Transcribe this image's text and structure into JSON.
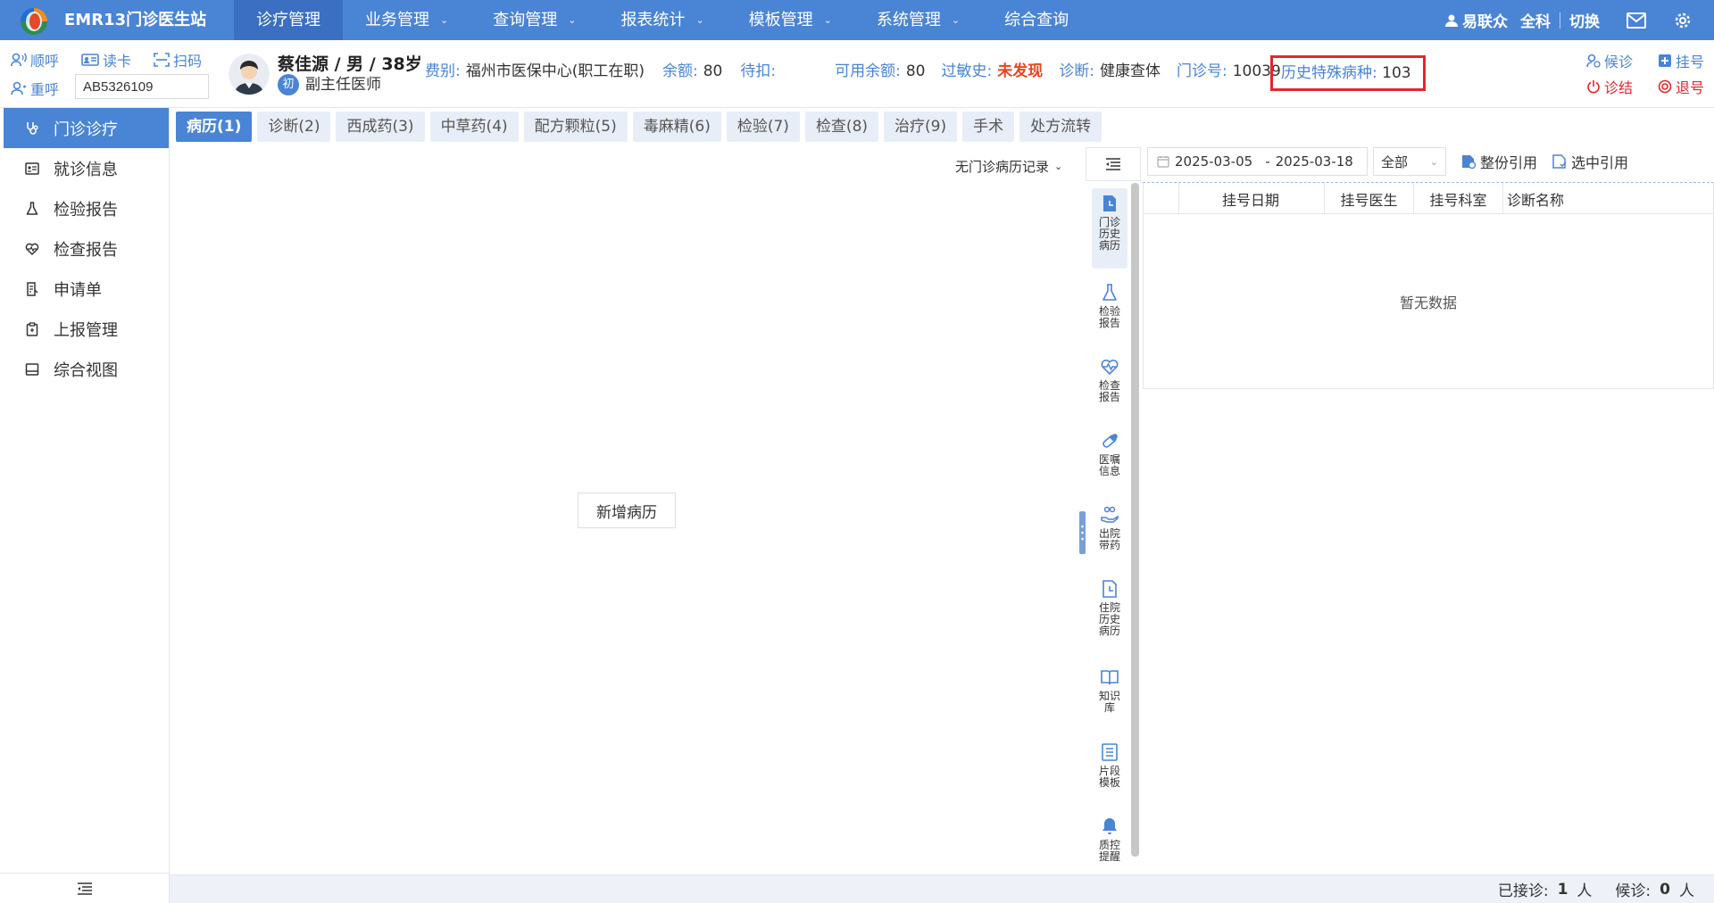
{
  "app": {
    "title": "EMR13门诊医生站"
  },
  "nav": [
    {
      "label": "诊疗管理",
      "active": true,
      "dropdown": false
    },
    {
      "label": "业务管理",
      "dropdown": true
    },
    {
      "label": "查询管理",
      "dropdown": true
    },
    {
      "label": "报表统计",
      "dropdown": true
    },
    {
      "label": "模板管理",
      "dropdown": true
    },
    {
      "label": "系统管理",
      "dropdown": true
    },
    {
      "label": "综合查询",
      "dropdown": false
    }
  ],
  "topright": {
    "user": "易联众",
    "dept": "全科",
    "switch_label": "切换"
  },
  "header": {
    "call_label": "顺呼",
    "readcard_label": "读卡",
    "scan_label": "扫码",
    "recall_label": "重呼",
    "card_value": "AB5326109",
    "wait_label": "候诊",
    "register_label": "挂号",
    "finish_label": "诊结",
    "cancel_label": "退号"
  },
  "patient": {
    "name_line": "蔡佳源 / 男 / 38岁",
    "badge": "初",
    "doctor_title": "副主任医师"
  },
  "info": {
    "fee_label": "费别:",
    "fee_value": "福州市医保中心(职工在职)",
    "balance_label": "余额:",
    "balance_value": "80",
    "pending_label": "待扣:",
    "pending_value": "",
    "available_label": "可用余额:",
    "available_value": "80",
    "allergy_label": "过敏史:",
    "allergy_value": "未发现",
    "diag_label": "诊断:",
    "diag_value": "健康查体",
    "clinic_label": "门诊号:",
    "clinic_value": "10039",
    "history_label": "历史特殊病种:",
    "history_value": "103"
  },
  "sidebar": [
    {
      "label": "门诊诊疗",
      "icon": "stethoscope-icon",
      "active": true
    },
    {
      "label": "就诊信息",
      "icon": "idcard-icon"
    },
    {
      "label": "检验报告",
      "icon": "flask-icon"
    },
    {
      "label": "检查报告",
      "icon": "heart-pulse-icon"
    },
    {
      "label": "申请单",
      "icon": "form-icon"
    },
    {
      "label": "上报管理",
      "icon": "clipboard-icon"
    },
    {
      "label": "综合视图",
      "icon": "panel-icon"
    }
  ],
  "tabs": [
    {
      "label": "病历(1)",
      "active": true
    },
    {
      "label": "诊断(2)"
    },
    {
      "label": "西成药(3)"
    },
    {
      "label": "中草药(4)"
    },
    {
      "label": "配方颗粒(5)"
    },
    {
      "label": "毒麻精(6)"
    },
    {
      "label": "检验(7)"
    },
    {
      "label": "检查(8)"
    },
    {
      "label": "治疗(9)"
    },
    {
      "label": "手术"
    },
    {
      "label": "处方流转"
    }
  ],
  "main": {
    "record_filter": "无门诊病历记录",
    "add_record_label": "新增病历"
  },
  "vbar": [
    {
      "label": "门诊历史病历",
      "icon": "doc-clock-icon",
      "active": true
    },
    {
      "label": "检验报告",
      "icon": "flask-icon"
    },
    {
      "label": "检查报告",
      "icon": "heart-pulse-icon"
    },
    {
      "label": "医嘱信息",
      "icon": "pill-icon"
    },
    {
      "label": "出院带药",
      "icon": "hand-pill-icon"
    },
    {
      "label": "住院历史病历",
      "icon": "doc-clock-icon"
    },
    {
      "label": "知识库",
      "icon": "book-icon"
    },
    {
      "label": "片段模板",
      "icon": "list-doc-icon"
    },
    {
      "label": "质控提醒",
      "icon": "bell-icon"
    }
  ],
  "history": {
    "date_from": "2025-03-05",
    "date_sep": "-",
    "date_to": "2025-03-18",
    "scope_selected": "全部",
    "whole_cite_label": "整份引用",
    "select_cite_label": "选中引用",
    "columns": [
      "挂号日期",
      "挂号医生",
      "挂号科室",
      "诊断名称"
    ],
    "empty_text": "暂无数据"
  },
  "status": {
    "received_label": "已接诊:",
    "received_value": "1",
    "received_unit": "人",
    "waiting_label": "候诊:",
    "waiting_value": "0",
    "waiting_unit": "人"
  },
  "colors": {
    "primary": "#4a84d4",
    "alert_red": "#e4262c",
    "allergy": "#e8451e"
  }
}
